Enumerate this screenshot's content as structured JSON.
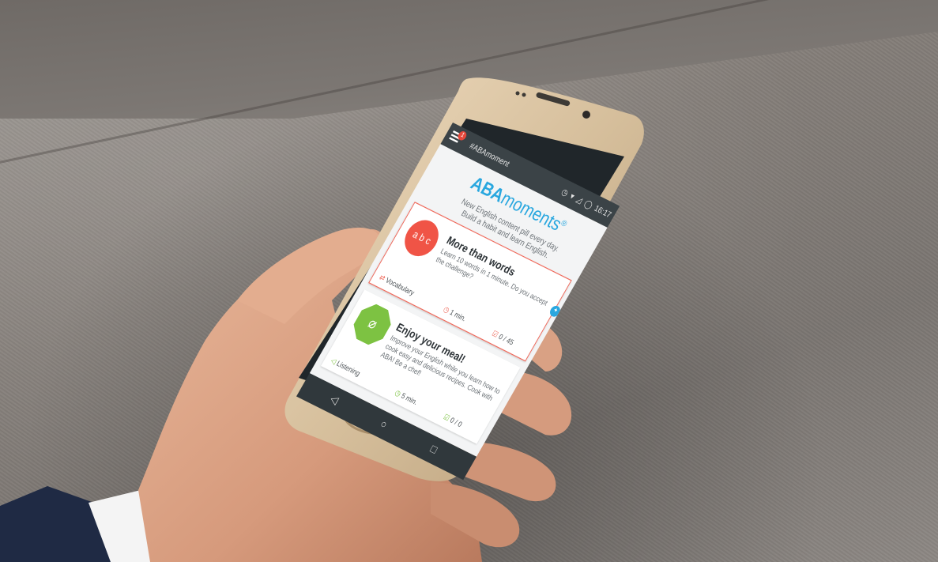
{
  "status_bar": {
    "app_title": "#ABAmoment",
    "notification_count": "1",
    "icons": "◷ ▾ ◿ ◯",
    "time": "16:17"
  },
  "header": {
    "logo_bold": "ABA",
    "logo_light": "moments",
    "logo_mark": "®",
    "tagline_line1": "New English content pill every day.",
    "tagline_line2": "Build a habit and learn English."
  },
  "cards": [
    {
      "title": "More than words",
      "description": "Learn 10 words in 1 minute. Do you accept the challenge?",
      "icon_text": "a b c",
      "icon": "letters-icon",
      "category": "Vocabulary",
      "duration": "1 min.",
      "progress": "0 / 45",
      "accent": "#f05446"
    },
    {
      "title": "Enjoy your meal!",
      "description": "Improve your English while you learn how to cook easy and delicious recipes. Cook with ABA! Be a chef!",
      "icon": "whisk-icon",
      "category": "Listening",
      "duration": "5 min.",
      "progress": "0 / 0",
      "accent": "#7dc242"
    }
  ],
  "nav": {
    "back": "◁",
    "home": "○",
    "recents": "□"
  },
  "colors": {
    "brand": "#29a7df",
    "status_bar": "#3b4347",
    "phone_gold": "#d9c3a2"
  }
}
